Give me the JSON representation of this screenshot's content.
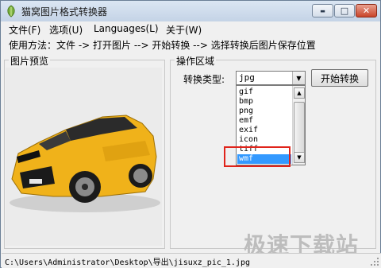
{
  "window": {
    "title": "猫窝图片格式转换器",
    "buttons": {
      "minimize": "▬",
      "maximize": "□",
      "close": "✕"
    }
  },
  "menu": [
    {
      "label": "文件(F)"
    },
    {
      "label": "选项(U)"
    },
    {
      "label": "Languages(L)"
    },
    {
      "label": "关于(W)"
    }
  ],
  "instructions": "使用方法：文件 -> 打开图片 --> 开始转换 --> 选择转换后图片保存位置",
  "preview": {
    "title": "图片预览",
    "colors": {
      "car": "#f0b21a",
      "background": "#ebebeb"
    }
  },
  "operations": {
    "title": "操作区域",
    "type_label": "转换类型:",
    "selected_format": "jpg",
    "start_button": "开始转换",
    "format_options": [
      "gif",
      "bmp",
      "png",
      "emf",
      "exif",
      "icon",
      "tiff",
      "wmf"
    ],
    "highlighted_option": "wmf",
    "colors": {
      "highlight": "#3399ff",
      "annotation": "#e0241b"
    }
  },
  "watermark": "极速下载站",
  "status": {
    "path": "C:\\Users\\Administrator\\Desktop\\导出\\jisuxz_pic_1.jpg"
  }
}
